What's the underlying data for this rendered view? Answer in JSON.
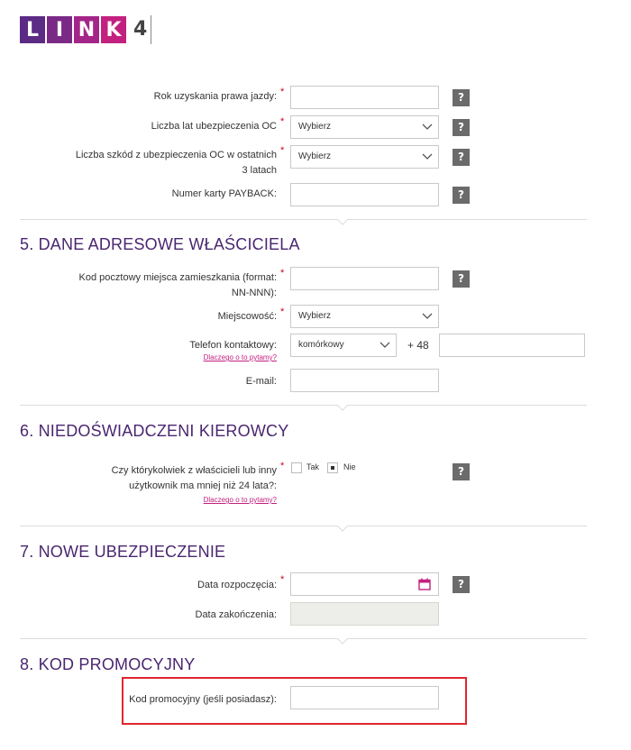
{
  "logo": {
    "letters": [
      "L",
      "I",
      "N",
      "K"
    ],
    "number": "4"
  },
  "section4": {
    "rows": [
      {
        "label": "Rok uzyskania prawa jazdy:",
        "required": true,
        "type": "input",
        "value": ""
      },
      {
        "label": "Liczba lat ubezpieczenia OC",
        "required": true,
        "type": "select",
        "value": "Wybierz"
      },
      {
        "label_line1": "Liczba szkód z ubezpieczenia OC w ostatnich",
        "label_line2": "3 latach",
        "required": true,
        "type": "select",
        "value": "Wybierz"
      },
      {
        "label": "Numer karty PAYBACK:",
        "required": false,
        "type": "input",
        "value": ""
      }
    ]
  },
  "section5": {
    "title": "5. DANE ADRESOWE WŁAŚCICIELA",
    "postal_label_line1": "Kod pocztowy miejsca zamieszkania (format:",
    "postal_label_line2": "NN-NNN):",
    "city_label": "Miejscowość:",
    "city_value": "Wybierz",
    "phone_label": "Telefon kontaktowy:",
    "phone_type_value": "komórkowy",
    "phone_prefix": "+ 48",
    "why_link": "Dlaczego o to pytamy?",
    "email_label": "E-mail:"
  },
  "section6": {
    "title": "6. NIEDOŚWIADCZENI KIEROWCY",
    "question_line1": "Czy którykolwiek z właścicieli lub inny",
    "question_line2": "użytkownik ma mniej niż 24 lata?:",
    "option_yes": "Tak",
    "option_no": "Nie",
    "selected": "Nie",
    "why_link": "Dlaczego o to pytamy?"
  },
  "section7": {
    "title": "7. NOWE UBEZPIECZENIE",
    "start_label": "Data rozpoczęcia:",
    "end_label": "Data zakończenia:"
  },
  "section8": {
    "title": "8. KOD PROMOCYJNY",
    "promo_label": "Kod promocyjny (jeśli posiadasz):"
  },
  "help_glyph": "?",
  "required_mark": "*",
  "colors": {
    "brand_purple": "#4a2670",
    "link_pink": "#c3217f",
    "required_red": "#d0021b",
    "highlight_red": "#e0262e",
    "help_gray": "#6b6b6b"
  }
}
